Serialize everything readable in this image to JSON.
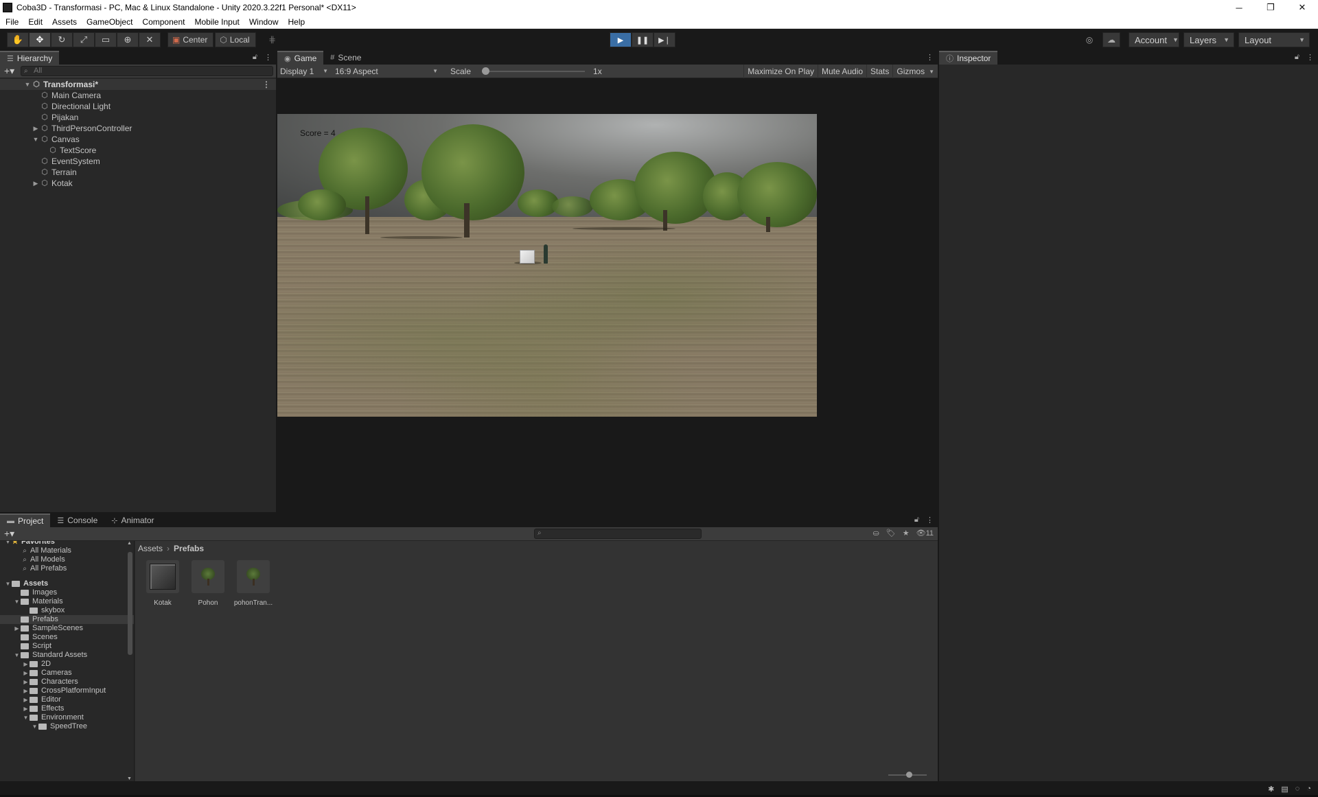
{
  "window": {
    "title": "Coba3D - Transformasi - PC, Mac & Linux Standalone - Unity 2020.3.22f1 Personal* <DX11>",
    "controls": [
      "─",
      "❐",
      "✕"
    ]
  },
  "menu": [
    "File",
    "Edit",
    "Assets",
    "GameObject",
    "Component",
    "Mobile Input",
    "Window",
    "Help"
  ],
  "toolbar": {
    "pivot_center": "Center",
    "pivot_local": "Local",
    "account": "Account",
    "layers": "Layers",
    "layout": "Layout"
  },
  "hierarchy": {
    "tab": "Hierarchy",
    "search_placeholder": "All",
    "scene": "Transformasi*",
    "items": [
      {
        "label": "Main Camera",
        "depth": 1,
        "expand": ""
      },
      {
        "label": "Directional Light",
        "depth": 1,
        "expand": ""
      },
      {
        "label": "Pijakan",
        "depth": 1,
        "expand": ""
      },
      {
        "label": "ThirdPersonController",
        "depth": 1,
        "expand": "▶"
      },
      {
        "label": "Canvas",
        "depth": 1,
        "expand": "▼"
      },
      {
        "label": "TextScore",
        "depth": 2,
        "expand": ""
      },
      {
        "label": "EventSystem",
        "depth": 1,
        "expand": ""
      },
      {
        "label": "Terrain",
        "depth": 1,
        "expand": ""
      },
      {
        "label": "Kotak",
        "depth": 1,
        "expand": "▶"
      }
    ]
  },
  "game": {
    "tabs": [
      "Game",
      "Scene"
    ],
    "display": "Display 1",
    "aspect": "16:9 Aspect",
    "scale_label": "Scale",
    "scale_value": "1x",
    "buttons": [
      "Maximize On Play",
      "Mute Audio",
      "Stats",
      "Gizmos"
    ],
    "score_text": "Score = 4"
  },
  "inspector": {
    "tab": "Inspector"
  },
  "project": {
    "tabs": [
      "Project",
      "Console",
      "Animator"
    ],
    "hidden_count": "11",
    "favorites_label": "Favorites",
    "favorites": [
      "All Materials",
      "All Models",
      "All Prefabs"
    ],
    "tree": [
      {
        "label": "Assets",
        "depth": 0,
        "expand": "▼",
        "head": true
      },
      {
        "label": "Images",
        "depth": 1,
        "expand": ""
      },
      {
        "label": "Materials",
        "depth": 1,
        "expand": "▼"
      },
      {
        "label": "skybox",
        "depth": 2,
        "expand": ""
      },
      {
        "label": "Prefabs",
        "depth": 1,
        "expand": "",
        "selected": true
      },
      {
        "label": "SampleScenes",
        "depth": 1,
        "expand": "▶"
      },
      {
        "label": "Scenes",
        "depth": 1,
        "expand": ""
      },
      {
        "label": "Script",
        "depth": 1,
        "expand": ""
      },
      {
        "label": "Standard Assets",
        "depth": 1,
        "expand": "▼"
      },
      {
        "label": "2D",
        "depth": 2,
        "expand": "▶"
      },
      {
        "label": "Cameras",
        "depth": 2,
        "expand": "▶"
      },
      {
        "label": "Characters",
        "depth": 2,
        "expand": "▶"
      },
      {
        "label": "CrossPlatformInput",
        "depth": 2,
        "expand": "▶"
      },
      {
        "label": "Editor",
        "depth": 2,
        "expand": "▶"
      },
      {
        "label": "Effects",
        "depth": 2,
        "expand": "▶"
      },
      {
        "label": "Environment",
        "depth": 2,
        "expand": "▼"
      },
      {
        "label": "SpeedTree",
        "depth": 3,
        "expand": "▼"
      }
    ],
    "breadcrumb": [
      "Assets",
      "Prefabs"
    ],
    "assets": [
      {
        "label": "Kotak",
        "kind": "cube"
      },
      {
        "label": "Pohon",
        "kind": "tree"
      },
      {
        "label": "pohonTran...",
        "kind": "tree"
      }
    ]
  }
}
